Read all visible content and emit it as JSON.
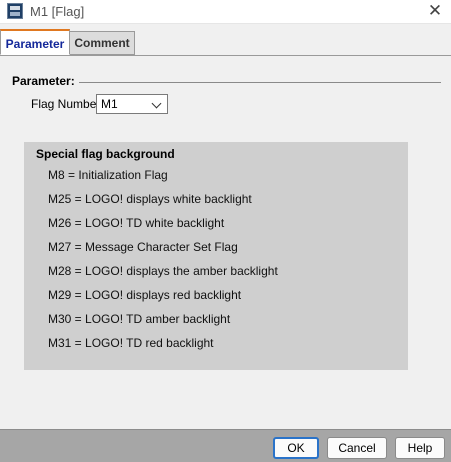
{
  "window": {
    "title": "M1 [Flag]"
  },
  "tabs": {
    "parameter": "Parameter",
    "comment": "Comment"
  },
  "parameter_group": {
    "label": "Parameter:"
  },
  "flag_number": {
    "label": "Flag Number:",
    "value": "M1"
  },
  "special_flags": {
    "heading": "Special flag background",
    "items": [
      "M8 = Initialization Flag",
      "M25 = LOGO! displays white backlight",
      "M26 = LOGO! TD white backlight",
      "M27 = Message Character Set Flag",
      "M28 = LOGO! displays the amber backlight",
      "M29 = LOGO! displays red backlight",
      "M30 = LOGO! TD amber backlight",
      "M31 = LOGO! TD red backlight"
    ]
  },
  "buttons": {
    "ok": "OK",
    "cancel": "Cancel",
    "help": "Help"
  },
  "colors": {
    "active_tab_text": "#14289a",
    "active_tab_accent": "#e07820",
    "default_button_border": "#2a73c9"
  }
}
